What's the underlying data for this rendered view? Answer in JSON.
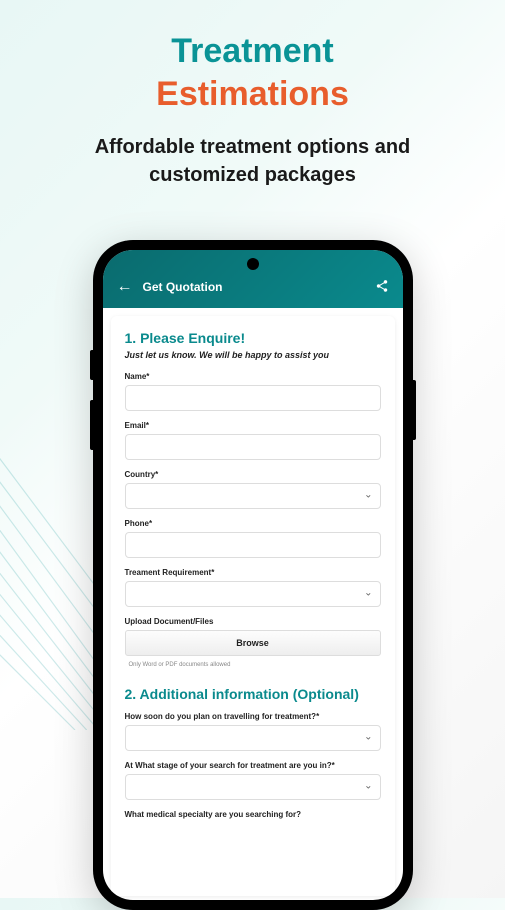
{
  "headline": {
    "word1": "Treatment",
    "word2": "Estimations"
  },
  "subheadline": "Affordable treatment options and customized packages",
  "app": {
    "title": "Get Quotation",
    "section1": {
      "title": "1. Please Enquire!",
      "subtitle": "Just let us know. We will be happy to assist you",
      "fields": {
        "name": "Name*",
        "email": "Email*",
        "country": "Country*",
        "phone": "Phone*",
        "treatment": "Treament Requirement*",
        "upload": "Upload Document/Files",
        "browse": "Browse",
        "fileHint": "Only Word or PDF documents allowed"
      }
    },
    "section2": {
      "title": "2. Additional information (Optional)",
      "q1": "How soon do you plan on travelling for treatment?*",
      "q2": "At What stage of your search for treatment are you in?*",
      "q3": "What medical specialty are you searching for?"
    }
  }
}
